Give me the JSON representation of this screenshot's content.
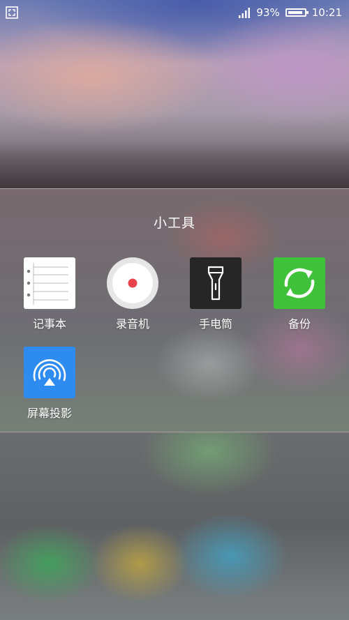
{
  "status_bar": {
    "left_icon": "screenshot-frame-icon",
    "signal_icon": "signal-bars-icon",
    "battery_percent": "93%",
    "battery_level": 0.93,
    "time": "10:21"
  },
  "folder": {
    "title": "小工具",
    "apps": [
      {
        "label": "记事本",
        "icon": "notepad-icon",
        "color": "#ffffff"
      },
      {
        "label": "录音机",
        "icon": "recorder-icon",
        "color": "#e6e6e6",
        "accent": "#e8424b"
      },
      {
        "label": "手电筒",
        "icon": "flashlight-icon",
        "color": "#262626"
      },
      {
        "label": "备份",
        "icon": "backup-sync-icon",
        "color": "#3fc23a"
      },
      {
        "label": "屏幕投影",
        "icon": "screen-cast-icon",
        "color": "#2e8cf0"
      }
    ]
  }
}
